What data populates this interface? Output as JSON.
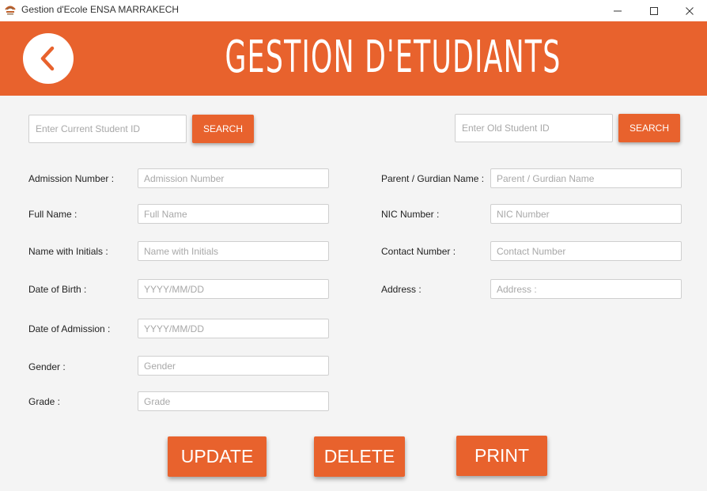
{
  "window": {
    "title": "Gestion d'Ecole ENSA MARRAKECH",
    "minimize_icon": "minimize-icon",
    "maximize_icon": "maximize-icon",
    "close_icon": "close-icon"
  },
  "header": {
    "title": "GESTION D'ETUDIANTS",
    "background_color": "#e8622d",
    "back_icon": "chevron-left-icon"
  },
  "search": {
    "current": {
      "placeholder": "Enter Current Student ID",
      "button_label": "SEARCH"
    },
    "old": {
      "placeholder": "Enter Old Student ID",
      "button_label": "SEARCH"
    }
  },
  "left_fields": [
    {
      "label": "Admission Number :",
      "placeholder": "Admission Number"
    },
    {
      "label": "Full Name :",
      "placeholder": "Full Name"
    },
    {
      "label": "Name with Initials :",
      "placeholder": "Name with Initials"
    },
    {
      "label": "Date of Birth :",
      "placeholder": "YYYY/MM/DD"
    },
    {
      "label": "Date of Admission :",
      "placeholder": "YYYY/MM/DD"
    },
    {
      "label": "Gender :",
      "placeholder": "Gender"
    },
    {
      "label": "Grade :",
      "placeholder": "Grade"
    }
  ],
  "right_fields": [
    {
      "label": "Parent / Gurdian Name :",
      "placeholder": "Parent / Gurdian Name"
    },
    {
      "label": "NIC Number :",
      "placeholder": "NIC Number"
    },
    {
      "label": "Contact Number :",
      "placeholder": "Contact Number"
    },
    {
      "label": "Address :",
      "placeholder": "Address :"
    }
  ],
  "actions": {
    "update_label": "UPDATE",
    "delete_label": "DELETE",
    "print_label": "PRINT"
  }
}
